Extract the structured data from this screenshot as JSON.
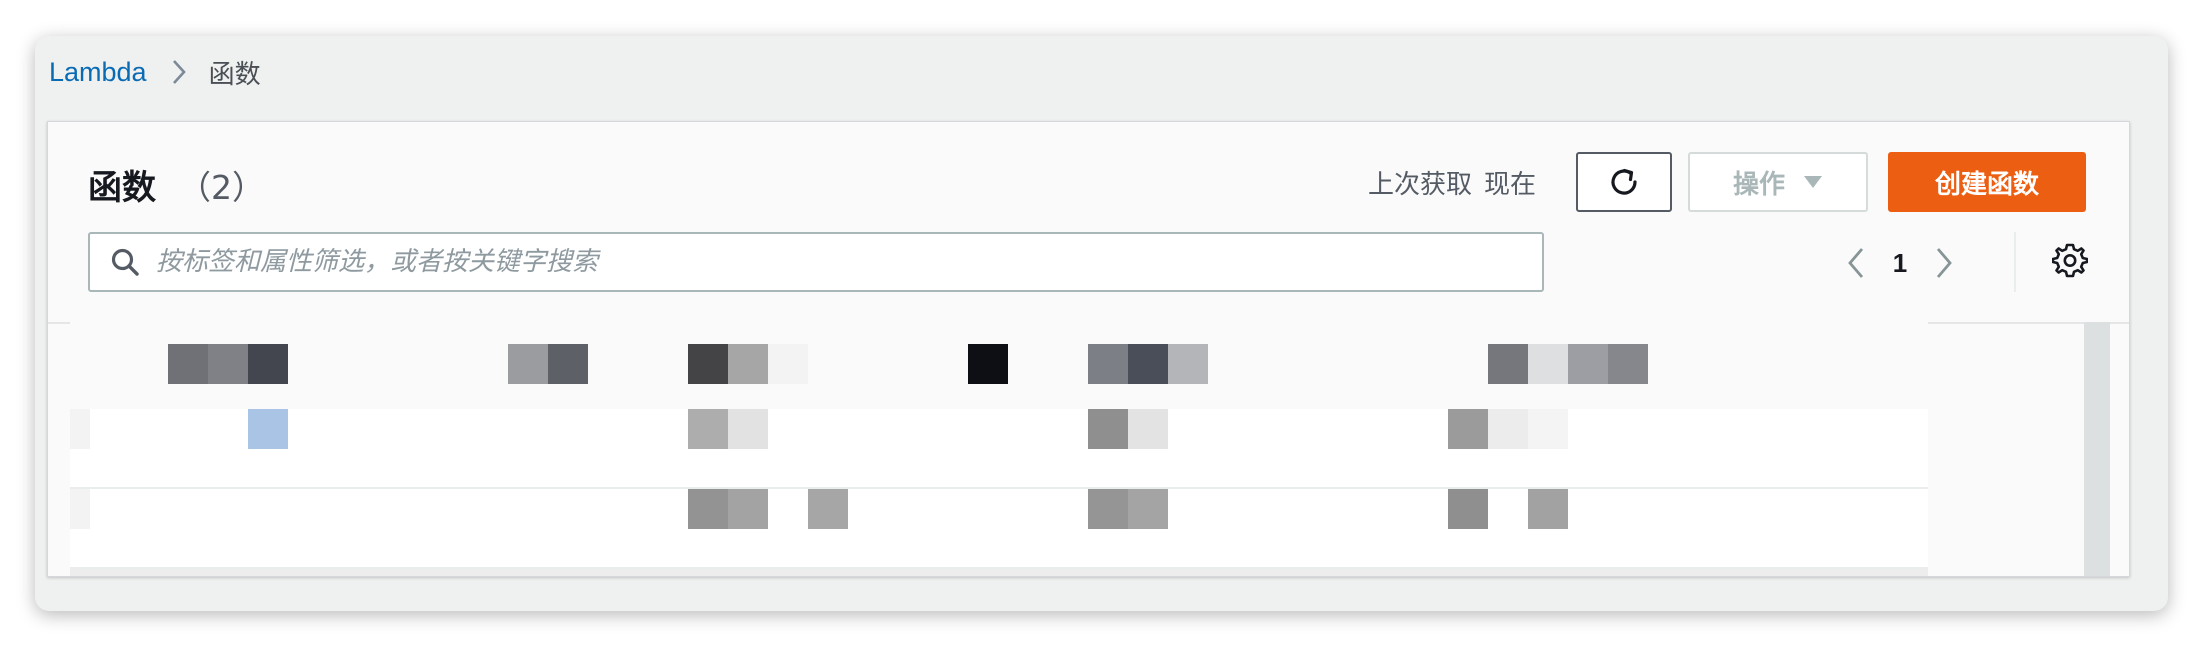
{
  "breadcrumb": {
    "root": "Lambda",
    "current": "函数"
  },
  "panel": {
    "title": "函数",
    "count": "（2）",
    "last_fetched_label": "上次获取",
    "last_fetched_value": "现在"
  },
  "toolbar": {
    "refresh_icon": "refresh-icon",
    "actions_label": "操作",
    "create_label": "创建函数"
  },
  "search": {
    "placeholder": "按标签和属性筛选，或者按关键字搜索",
    "value": ""
  },
  "pagination": {
    "current_page": "1"
  },
  "colors": {
    "link": "#0a6bb5",
    "primary_button": "#ec5e12",
    "text_dark": "#16191f",
    "text_muted": "#545b64"
  }
}
